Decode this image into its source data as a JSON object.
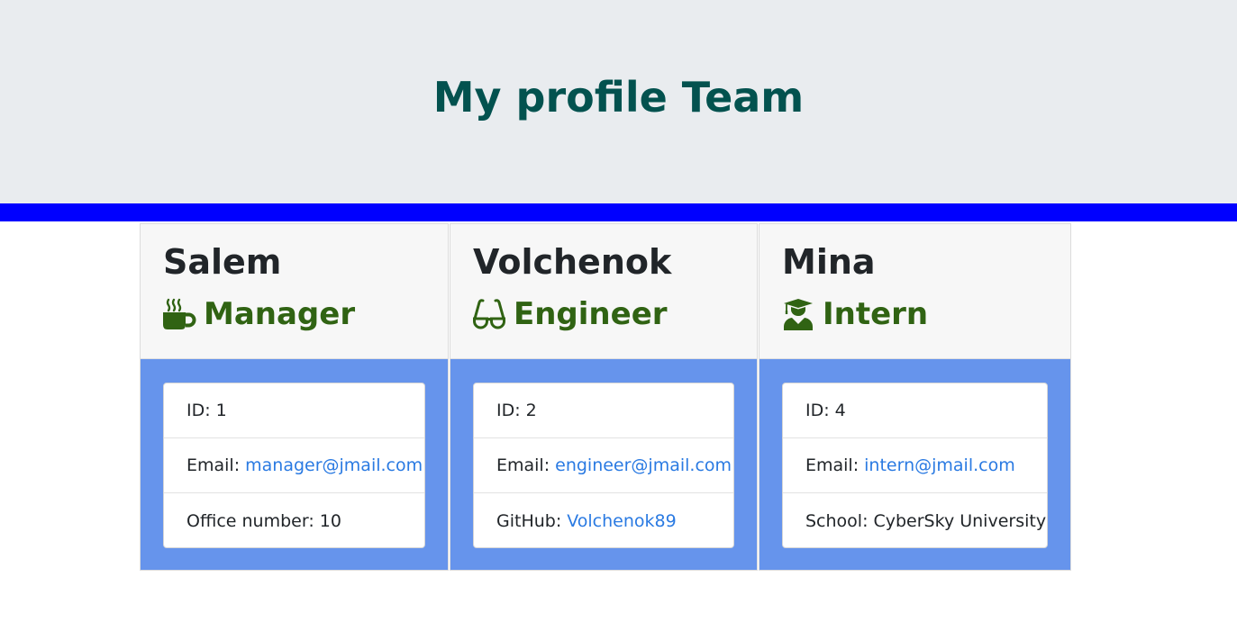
{
  "header": {
    "title": "My profile Team"
  },
  "colors": {
    "title": "#03524f",
    "divider": "#0000ff",
    "card_body": "#6694ec",
    "role": "#306313",
    "link": "#2a7ae2"
  },
  "team": [
    {
      "name": "Salem",
      "role": "Manager",
      "icon": "coffee-mug-icon",
      "id_label": "ID:",
      "id": "1",
      "email_label": "Email:",
      "email": "manager@jmail.com",
      "extra_label": "Office number:",
      "extra_value": "10"
    },
    {
      "name": "Volchenok",
      "role": "Engineer",
      "icon": "glasses-icon",
      "id_label": "ID:",
      "id": "2",
      "email_label": "Email:",
      "email": "engineer@jmail.com",
      "extra_label": "GitHub:",
      "extra_value": "Volchenok89"
    },
    {
      "name": "Mina",
      "role": "Intern",
      "icon": "graduate-icon",
      "id_label": "ID:",
      "id": "4",
      "email_label": "Email:",
      "email": "intern@jmail.com",
      "extra_label": "School:",
      "extra_value": "CyberSky University"
    }
  ]
}
